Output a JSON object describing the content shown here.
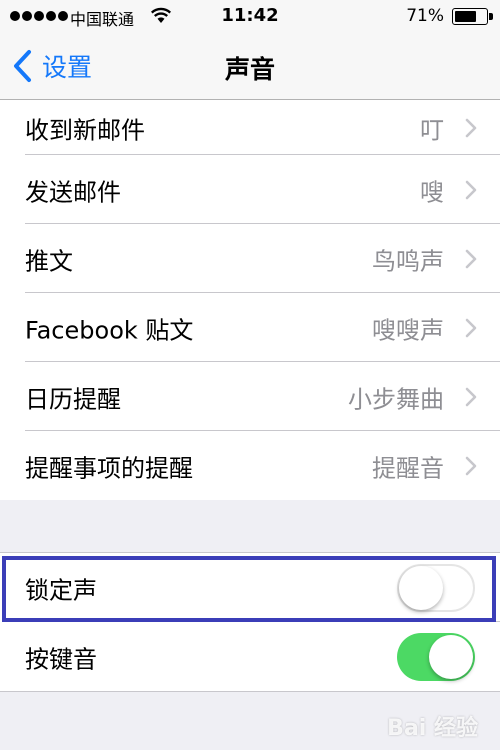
{
  "status_bar": {
    "carrier": "中国联通",
    "time": "11:42",
    "battery_percent": "71%",
    "battery_level": 0.71,
    "signal_bars": 5
  },
  "nav": {
    "back_label": "设置",
    "title": "声音"
  },
  "sounds": [
    {
      "label": "收到新邮件",
      "value": "叮"
    },
    {
      "label": "发送邮件",
      "value": "嗖"
    },
    {
      "label": "推文",
      "value": "鸟鸣声"
    },
    {
      "label": "Facebook 贴文",
      "value": "嗖嗖声"
    },
    {
      "label": "日历提醒",
      "value": "小步舞曲"
    },
    {
      "label": "提醒事项的提醒",
      "value": "提醒音"
    }
  ],
  "toggles": [
    {
      "label": "锁定声",
      "on": false
    },
    {
      "label": "按键音",
      "on": true
    }
  ],
  "watermark": "Bai 经验",
  "colors": {
    "accent": "#1478fa",
    "toggle_on": "#4cd964",
    "highlight_box": "#3b3eb8",
    "secondary_text": "#8e8e93",
    "background": "#efeff4"
  }
}
